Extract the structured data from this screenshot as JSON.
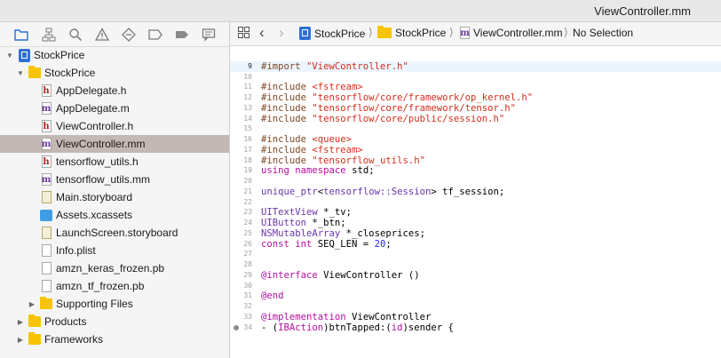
{
  "window": {
    "title": "ViewController.mm"
  },
  "navigator": {
    "toolbar_icons": [
      "folder-icon",
      "hierarchy-icon",
      "search-icon",
      "warning-icon",
      "diamond-icon",
      "breakpoint-icon",
      "tag-icon",
      "comment-icon"
    ],
    "tree": [
      {
        "label": "StockPrice",
        "kind": "project",
        "indent": 0,
        "disclosure": "open"
      },
      {
        "label": "StockPrice",
        "kind": "folder",
        "indent": 1,
        "disclosure": "open"
      },
      {
        "label": "AppDelegate.h",
        "kind": "h",
        "indent": 2
      },
      {
        "label": "AppDelegate.m",
        "kind": "m",
        "indent": 2
      },
      {
        "label": "ViewController.h",
        "kind": "h",
        "indent": 2
      },
      {
        "label": "ViewController.mm",
        "kind": "m",
        "indent": 2,
        "selected": true
      },
      {
        "label": "tensorflow_utils.h",
        "kind": "h",
        "indent": 2
      },
      {
        "label": "tensorflow_utils.mm",
        "kind": "m",
        "indent": 2
      },
      {
        "label": "Main.storyboard",
        "kind": "story",
        "indent": 2
      },
      {
        "label": "Assets.xcassets",
        "kind": "assets",
        "indent": 2
      },
      {
        "label": "LaunchScreen.storyboard",
        "kind": "story",
        "indent": 2
      },
      {
        "label": "Info.plist",
        "kind": "plain",
        "indent": 2
      },
      {
        "label": "amzn_keras_frozen.pb",
        "kind": "plain",
        "indent": 2
      },
      {
        "label": "amzn_tf_frozen.pb",
        "kind": "plain",
        "indent": 2
      },
      {
        "label": "Supporting Files",
        "kind": "folder",
        "indent": 2,
        "disclosure": "closed"
      },
      {
        "label": "Products",
        "kind": "folder",
        "indent": 1,
        "disclosure": "closed"
      },
      {
        "label": "Frameworks",
        "kind": "folder",
        "indent": 1,
        "disclosure": "closed"
      }
    ]
  },
  "jumpbar": {
    "crumbs": [
      "StockPrice",
      "StockPrice",
      "ViewController.mm",
      "No Selection"
    ]
  },
  "editor": {
    "lines": [
      {
        "n": "",
        "parts": []
      },
      {
        "n": "9",
        "current": true,
        "parts": [
          [
            "pp",
            "#import "
          ],
          [
            "str",
            "\"ViewController.h\""
          ]
        ]
      },
      {
        "n": "10",
        "parts": []
      },
      {
        "n": "11",
        "parts": [
          [
            "pp",
            "#include "
          ],
          [
            "str",
            "<fstream>"
          ]
        ]
      },
      {
        "n": "12",
        "parts": [
          [
            "pp",
            "#include "
          ],
          [
            "str",
            "\"tensorflow/core/framework/op_kernel.h\""
          ]
        ]
      },
      {
        "n": "13",
        "parts": [
          [
            "pp",
            "#include "
          ],
          [
            "str",
            "\"tensorflow/core/framework/tensor.h\""
          ]
        ]
      },
      {
        "n": "14",
        "parts": [
          [
            "pp",
            "#include "
          ],
          [
            "str",
            "\"tensorflow/core/public/session.h\""
          ]
        ]
      },
      {
        "n": "15",
        "parts": []
      },
      {
        "n": "16",
        "parts": [
          [
            "pp",
            "#include "
          ],
          [
            "str",
            "<queue>"
          ]
        ]
      },
      {
        "n": "17",
        "parts": [
          [
            "pp",
            "#include "
          ],
          [
            "str",
            "<fstream>"
          ]
        ]
      },
      {
        "n": "18",
        "parts": [
          [
            "pp",
            "#include "
          ],
          [
            "str",
            "\"tensorflow_utils.h\""
          ]
        ]
      },
      {
        "n": "19",
        "parts": [
          [
            "kw",
            "using namespace "
          ],
          [
            "plain",
            "std;"
          ]
        ]
      },
      {
        "n": "20",
        "parts": []
      },
      {
        "n": "21",
        "parts": [
          [
            "ty",
            "unique_ptr"
          ],
          [
            "plain",
            "<"
          ],
          [
            "ty",
            "tensorflow::Session"
          ],
          [
            "plain",
            "> tf_session;"
          ]
        ]
      },
      {
        "n": "22",
        "parts": []
      },
      {
        "n": "23",
        "parts": [
          [
            "ty",
            "UITextView"
          ],
          [
            "plain",
            " *_tv;"
          ]
        ]
      },
      {
        "n": "24",
        "parts": [
          [
            "ty",
            "UIButton"
          ],
          [
            "plain",
            " *_btn;"
          ]
        ]
      },
      {
        "n": "25",
        "parts": [
          [
            "ty",
            "NSMutableArray"
          ],
          [
            "plain",
            " *_closeprices;"
          ]
        ]
      },
      {
        "n": "26",
        "parts": [
          [
            "kw",
            "const int "
          ],
          [
            "plain",
            "SEQ_LEN = "
          ],
          [
            "num",
            "20"
          ],
          [
            "plain",
            ";"
          ]
        ]
      },
      {
        "n": "27",
        "parts": []
      },
      {
        "n": "28",
        "parts": []
      },
      {
        "n": "29",
        "parts": [
          [
            "kw",
            "@interface "
          ],
          [
            "plain",
            "ViewController ()"
          ]
        ]
      },
      {
        "n": "30",
        "parts": []
      },
      {
        "n": "31",
        "parts": [
          [
            "kw",
            "@end"
          ]
        ]
      },
      {
        "n": "32",
        "parts": []
      },
      {
        "n": "33",
        "parts": [
          [
            "kw",
            "@implementation "
          ],
          [
            "plain",
            "ViewController"
          ]
        ]
      },
      {
        "n": "34",
        "breakpoint": true,
        "parts": [
          [
            "plain",
            "- ("
          ],
          [
            "kw",
            "IBAction"
          ],
          [
            "plain",
            ")btnTapped:("
          ],
          [
            "kw",
            "id"
          ],
          [
            "plain",
            ")sender {"
          ]
        ]
      }
    ]
  }
}
